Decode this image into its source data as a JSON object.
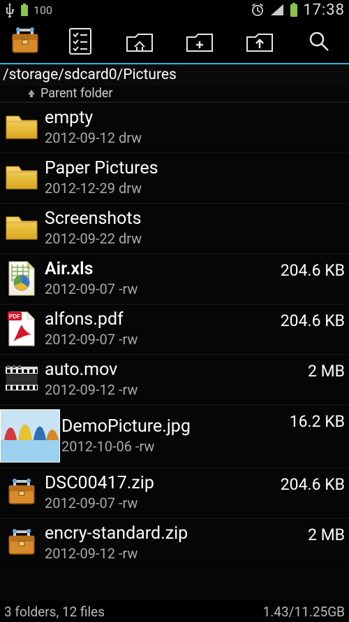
{
  "status": {
    "battery_pct": "100",
    "time": "17:38"
  },
  "toolbar": {},
  "path": "/storage/sdcard0/Pictures",
  "parent_label": "Parent folder",
  "items": [
    {
      "name": "empty",
      "meta": "2012-09-12 drw",
      "size": "",
      "icon": "folder",
      "bold": false
    },
    {
      "name": "Paper Pictures",
      "meta": "2012-12-29 drw",
      "size": "",
      "icon": "folder",
      "bold": false
    },
    {
      "name": "Screenshots",
      "meta": "2012-09-22 drw",
      "size": "",
      "icon": "folder",
      "bold": false
    },
    {
      "name": "Air.xls",
      "meta": "2012-09-07 -rw",
      "size": "204.6 KB",
      "icon": "xls",
      "bold": true
    },
    {
      "name": "alfons.pdf",
      "meta": "2012-09-07 -rw",
      "size": "204.6 KB",
      "icon": "pdf",
      "bold": false
    },
    {
      "name": "auto.mov",
      "meta": "2012-09-12 -rw",
      "size": "2 MB",
      "icon": "mov",
      "bold": false
    },
    {
      "name": "DemoPicture.jpg",
      "meta": "2012-10-06 -rw",
      "size": "16.2 KB",
      "icon": "jpg",
      "bold": false,
      "large": true
    },
    {
      "name": "DSC00417.zip",
      "meta": "2012-09-07 -rw",
      "size": "204.6 KB",
      "icon": "zip",
      "bold": false
    },
    {
      "name": "encry-standard.zip",
      "meta": "2012-09-12 -rw",
      "size": "2 MB",
      "icon": "zip",
      "bold": false
    }
  ],
  "footer": {
    "summary": "3 folders, 12 files",
    "space": "1.43/11.25GB"
  }
}
